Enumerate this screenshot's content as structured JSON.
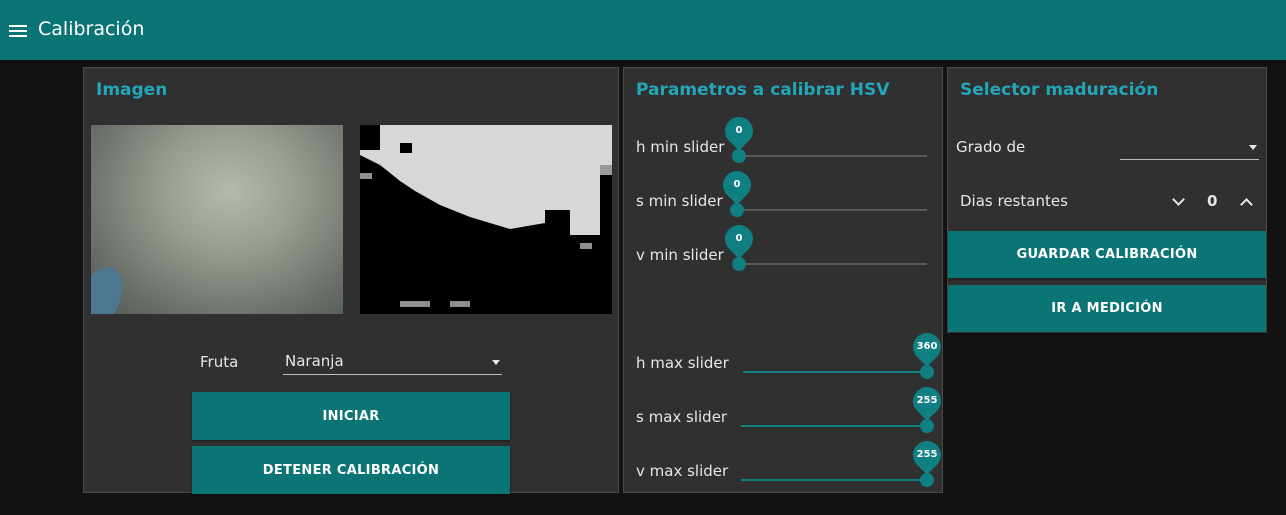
{
  "appbar": {
    "title": "Calibración",
    "menu_icon": "menu-icon"
  },
  "image_panel": {
    "title": "Imagen",
    "fruit_label": "Fruta",
    "fruit_value": "Naranja",
    "start_button": "INICIAR",
    "stop_button": "DETENER CALIBRACIÓN"
  },
  "hsv_panel": {
    "title": "Parametros a calibrar HSV",
    "sliders": [
      {
        "label": "h min slider",
        "value": "0",
        "fraction": 0
      },
      {
        "label": "s min slider",
        "value": "0",
        "fraction": 0
      },
      {
        "label": "v min slider",
        "value": "0",
        "fraction": 0
      },
      {
        "label": "h max slider",
        "value": "360",
        "fraction": 1
      },
      {
        "label": "s max slider",
        "value": "255",
        "fraction": 1
      },
      {
        "label": "v max slider",
        "value": "255",
        "fraction": 1
      }
    ]
  },
  "ripeness_panel": {
    "title": "Selector maduración",
    "grade_label": "Grado de",
    "grade_value": "",
    "days_label": "Dias restantes",
    "days_value": "0",
    "save_button": "GUARDAR CALIBRACIÓN",
    "measure_button": "IR A MEDICIÓN"
  },
  "colors": {
    "accent": "#0b7475",
    "title": "#23a6b8",
    "panel": "#303030",
    "background": "#121212"
  }
}
